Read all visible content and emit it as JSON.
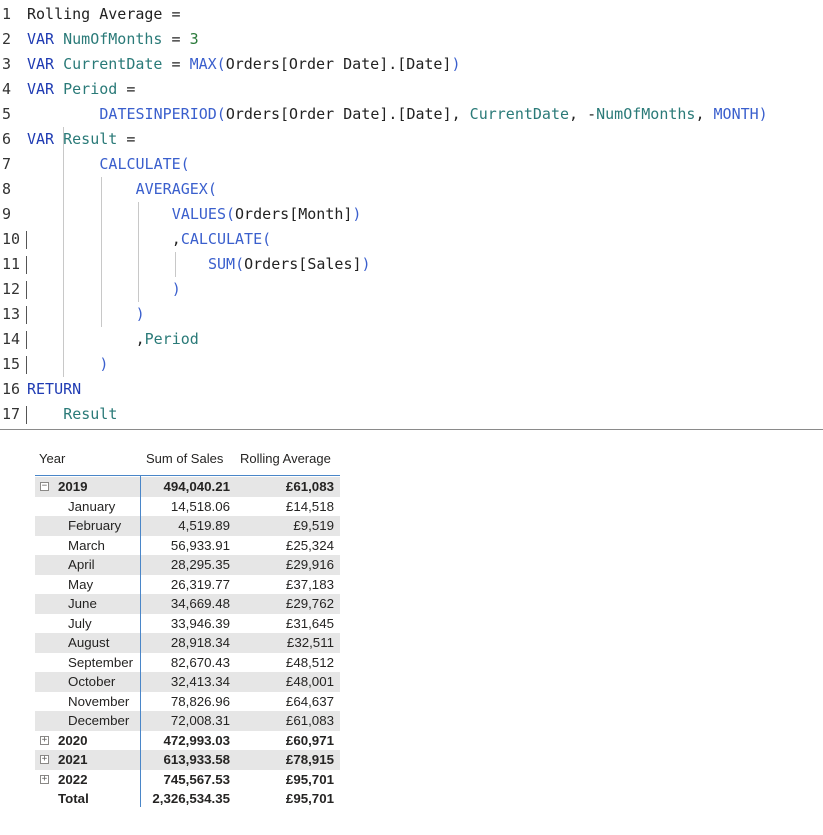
{
  "code": {
    "lines": [
      {
        "n": "1",
        "tokens": [
          {
            "t": "Rolling Average =",
            "c": "pl"
          }
        ]
      },
      {
        "n": "2",
        "tokens": [
          {
            "t": "VAR ",
            "c": "kw"
          },
          {
            "t": "NumOfMonths",
            "c": "vr"
          },
          {
            "t": " = ",
            "c": "pl"
          },
          {
            "t": "3",
            "c": "nm"
          }
        ]
      },
      {
        "n": "3",
        "tokens": [
          {
            "t": "VAR ",
            "c": "kw"
          },
          {
            "t": "CurrentDate",
            "c": "vr"
          },
          {
            "t": " = ",
            "c": "pl"
          },
          {
            "t": "MAX(",
            "c": "fn"
          },
          {
            "t": "Orders[Order Date].[Date]",
            "c": "pl"
          },
          {
            "t": ")",
            "c": "fn"
          }
        ]
      },
      {
        "n": "4",
        "tokens": [
          {
            "t": "VAR ",
            "c": "kw"
          },
          {
            "t": "Period",
            "c": "vr"
          },
          {
            "t": " =",
            "c": "pl"
          }
        ]
      },
      {
        "n": "5",
        "tokens": [
          {
            "t": "DATESINPERIOD(",
            "c": "fn"
          },
          {
            "t": "Orders[Order Date].[Date]",
            "c": "pl"
          },
          {
            "t": ", ",
            "c": "pl"
          },
          {
            "t": "CurrentDate",
            "c": "vr"
          },
          {
            "t": ", -",
            "c": "pl"
          },
          {
            "t": "NumOfMonths",
            "c": "vr"
          },
          {
            "t": ", ",
            "c": "pl"
          },
          {
            "t": "MONTH",
            "c": "fn"
          },
          {
            "t": ")",
            "c": "fn"
          }
        ]
      },
      {
        "n": "6",
        "tokens": [
          {
            "t": "VAR ",
            "c": "kw"
          },
          {
            "t": "Result",
            "c": "vr"
          },
          {
            "t": " =",
            "c": "pl"
          }
        ]
      },
      {
        "n": "7",
        "tokens": [
          {
            "t": "CALCULATE(",
            "c": "fn"
          }
        ]
      },
      {
        "n": "8",
        "tokens": [
          {
            "t": "AVERAGEX(",
            "c": "fn"
          }
        ]
      },
      {
        "n": "9",
        "tokens": [
          {
            "t": "VALUES(",
            "c": "fn"
          },
          {
            "t": "Orders[Month]",
            "c": "pl"
          },
          {
            "t": ")",
            "c": "fn"
          }
        ]
      },
      {
        "n": "10",
        "tokens": [
          {
            "t": ",",
            "c": "pl"
          },
          {
            "t": "CALCULATE(",
            "c": "fn"
          }
        ]
      },
      {
        "n": "11",
        "tokens": [
          {
            "t": "SUM(",
            "c": "fn"
          },
          {
            "t": "Orders[Sales]",
            "c": "pl"
          },
          {
            "t": ")",
            "c": "fn"
          }
        ]
      },
      {
        "n": "12",
        "tokens": [
          {
            "t": ")",
            "c": "fn"
          }
        ]
      },
      {
        "n": "13",
        "tokens": [
          {
            "t": ")",
            "c": "fn"
          }
        ]
      },
      {
        "n": "14",
        "tokens": [
          {
            "t": ",",
            "c": "pl"
          },
          {
            "t": "Period",
            "c": "vr"
          }
        ]
      },
      {
        "n": "15",
        "tokens": [
          {
            "t": ")",
            "c": "fn"
          }
        ]
      },
      {
        "n": "16",
        "tokens": [
          {
            "t": "RETURN",
            "c": "kw"
          }
        ]
      },
      {
        "n": "17",
        "tokens": [
          {
            "t": "Result",
            "c": "vr"
          }
        ]
      }
    ]
  },
  "matrix": {
    "headers": {
      "year": "Year",
      "sum_of_sales": "Sum of Sales",
      "rolling_average": "Rolling Average"
    },
    "rows": [
      {
        "kind": "year",
        "toggle": "−",
        "label": "2019",
        "sales": "494,040.21",
        "avg": "£61,083"
      },
      {
        "kind": "month",
        "label": "January",
        "sales": "14,518.06",
        "avg": "£14,518"
      },
      {
        "kind": "month",
        "label": "February",
        "sales": "4,519.89",
        "avg": "£9,519"
      },
      {
        "kind": "month",
        "label": "March",
        "sales": "56,933.91",
        "avg": "£25,324"
      },
      {
        "kind": "month",
        "label": "April",
        "sales": "28,295.35",
        "avg": "£29,916"
      },
      {
        "kind": "month",
        "label": "May",
        "sales": "26,319.77",
        "avg": "£37,183"
      },
      {
        "kind": "month",
        "label": "June",
        "sales": "34,669.48",
        "avg": "£29,762"
      },
      {
        "kind": "month",
        "label": "July",
        "sales": "33,946.39",
        "avg": "£31,645"
      },
      {
        "kind": "month",
        "label": "August",
        "sales": "28,918.34",
        "avg": "£32,511"
      },
      {
        "kind": "month",
        "label": "September",
        "sales": "82,670.43",
        "avg": "£48,512"
      },
      {
        "kind": "month",
        "label": "October",
        "sales": "32,413.34",
        "avg": "£48,001"
      },
      {
        "kind": "month",
        "label": "November",
        "sales": "78,826.96",
        "avg": "£64,637"
      },
      {
        "kind": "month",
        "label": "December",
        "sales": "72,008.31",
        "avg": "£61,083"
      },
      {
        "kind": "year",
        "toggle": "+",
        "label": "2020",
        "sales": "472,993.03",
        "avg": "£60,971"
      },
      {
        "kind": "year",
        "toggle": "+",
        "label": "2021",
        "sales": "613,933.58",
        "avg": "£78,915"
      },
      {
        "kind": "year",
        "toggle": "+",
        "label": "2022",
        "sales": "745,567.53",
        "avg": "£95,701"
      },
      {
        "kind": "total",
        "label": "Total",
        "sales": "2,326,534.35",
        "avg": "£95,701"
      }
    ]
  },
  "colors": {
    "keyword": "#1f3bb3",
    "function": "#3a5fcd",
    "variable": "#2a7a78",
    "number": "#2b7a3b",
    "matrix_accent": "#4a86c8",
    "row_shade": "#e6e6e6"
  }
}
